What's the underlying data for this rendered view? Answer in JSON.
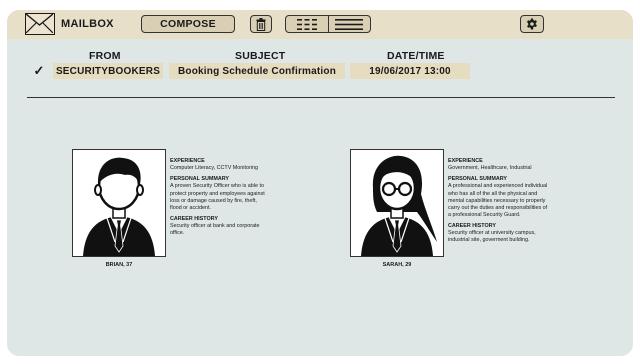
{
  "toolbar": {
    "app_label": "MAILBOX",
    "compose_label": "COMPOSE",
    "icons": [
      "mail-icon",
      "trash-icon",
      "grid-view-icon",
      "list-view-icon",
      "gear-icon"
    ]
  },
  "table": {
    "columns": [
      "FROM",
      "SUBJECT",
      "DATE/TIME"
    ],
    "rows": [
      {
        "checked": true,
        "check_mark": "✓",
        "from": "SECURITYBOOKERS",
        "subject": "Booking Schedule Confirmation",
        "datetime": "19/06/2017  13:00"
      }
    ]
  },
  "profiles": [
    {
      "caption": "BRIAN, 37",
      "experience_label": "EXPERIENCE",
      "experience": "Computer Literacy, CCTV Monitoring",
      "summary_label": "PERSONAL SUMMARY",
      "summary": "A proven Security Officer who is able to protect property and employees against loss or damage caused by fire, theft, flood or accident.",
      "history_label": "CAREER HISTORY",
      "history": "Security officer at bank and corporate office."
    },
    {
      "caption": "SARAH, 29",
      "experience_label": "EXPERIENCE",
      "experience": "Government, Healthcare, Industrial",
      "summary_label": "PERSONAL SUMMARY",
      "summary": "A professional and experienced individual who has all of the all the physical and mental capabilities necessary to properly carry out the duties and responsibilities of a professional Security Guard.",
      "history_label": "CAREER HISTORY",
      "history": "Security officer at university campus, industrial site, goverment building."
    }
  ],
  "colors": {
    "toolbar_bg": "#e8dfc9",
    "panel_bg": "#dfe6e6",
    "cell_bg": "#e6dcbf",
    "ink": "#1a1a1a"
  }
}
